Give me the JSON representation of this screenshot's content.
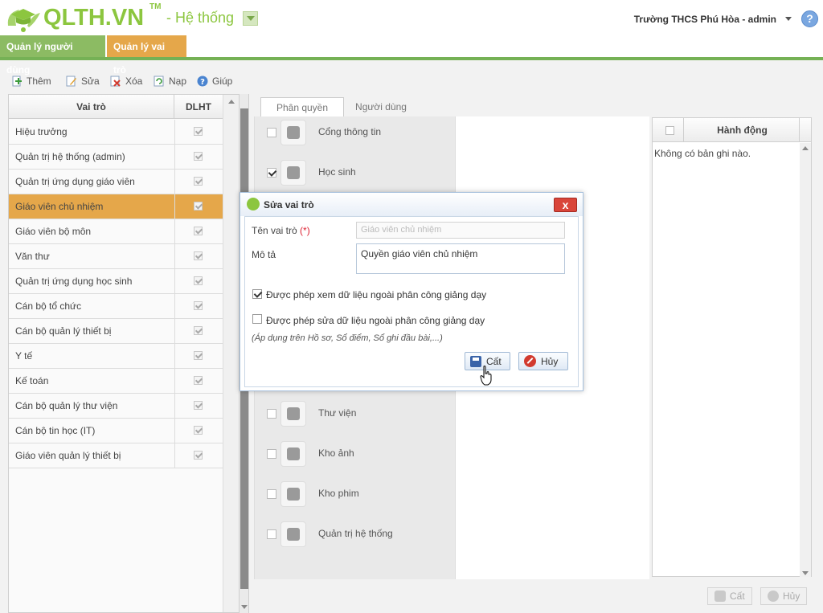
{
  "header": {
    "logo_text": "QLTH.VN",
    "logo_tm": "TM",
    "system_title": "- Hệ thống",
    "user_info": "Trường THCS Phú Hòa - admin",
    "help_label": "?"
  },
  "main_tabs": [
    {
      "label": "Quản lý người dùng"
    },
    {
      "label": "Quản lý vai trò"
    }
  ],
  "toolbar": {
    "add": "Thêm",
    "edit": "Sửa",
    "delete": "Xóa",
    "reload": "Nạp",
    "help": "Giúp"
  },
  "roles": {
    "col_role": "Vai trò",
    "col_dlht": "DLHT",
    "items": [
      {
        "name": "Hiệu trưởng",
        "dlht": true
      },
      {
        "name": "Quản trị hệ thống (admin)",
        "dlht": true
      },
      {
        "name": "Quản trị ứng dụng giáo viên",
        "dlht": true
      },
      {
        "name": "Giáo viên chủ nhiệm",
        "dlht": true,
        "selected": true
      },
      {
        "name": "Giáo viên bộ môn",
        "dlht": true
      },
      {
        "name": "Văn thư",
        "dlht": true
      },
      {
        "name": "Quản trị ứng dụng học sinh",
        "dlht": true
      },
      {
        "name": "Cán bộ tổ chức",
        "dlht": true
      },
      {
        "name": "Cán bộ quản lý thiết bị",
        "dlht": true
      },
      {
        "name": "Y tế",
        "dlht": true
      },
      {
        "name": "Kế toán",
        "dlht": true
      },
      {
        "name": "Cán bộ quản lý thư viện",
        "dlht": true
      },
      {
        "name": "Cán bộ tin học (IT)",
        "dlht": true
      },
      {
        "name": "Giáo viên quản lý thiết bị",
        "dlht": true
      }
    ]
  },
  "right_tabs": [
    {
      "label": "Phân quyền"
    },
    {
      "label": "Người dùng"
    }
  ],
  "permissions": [
    {
      "label": "Cổng thông tin",
      "checked": false
    },
    {
      "label": "Học sinh",
      "checked": true
    },
    {
      "label": "Thư viện",
      "checked": false
    },
    {
      "label": "Kho ảnh",
      "checked": false
    },
    {
      "label": "Kho phim",
      "checked": false
    },
    {
      "label": "Quản trị hệ thống",
      "checked": false
    }
  ],
  "actions": {
    "header": "Hành động",
    "empty": "Không có bản ghi nào."
  },
  "bottom": {
    "save": "Cất",
    "cancel": "Hủy"
  },
  "modal": {
    "title": "Sửa vai trò",
    "close": "x",
    "role_name_label": "Tên vai trò",
    "required_mark": "(*)",
    "role_name_value": "Giáo viên chủ nhiệm",
    "desc_label": "Mô tả",
    "desc_value": "Quyền giáo viên chủ nhiệm",
    "opt_view": "Được phép xem dữ liệu ngoài phân công giảng dạy",
    "opt_view_checked": true,
    "opt_edit": "Được phép sửa dữ liệu ngoài phân công giảng dạy",
    "opt_edit_checked": false,
    "note": "(Áp dụng trên Hồ sơ, Sổ điểm, Sổ ghi đầu bài,...)",
    "save": "Cất",
    "cancel": "Hủy"
  },
  "colors": {
    "brand_green": "#8cc63f",
    "tab_orange": "#e5a74a",
    "tab_green": "#8cbb63"
  }
}
